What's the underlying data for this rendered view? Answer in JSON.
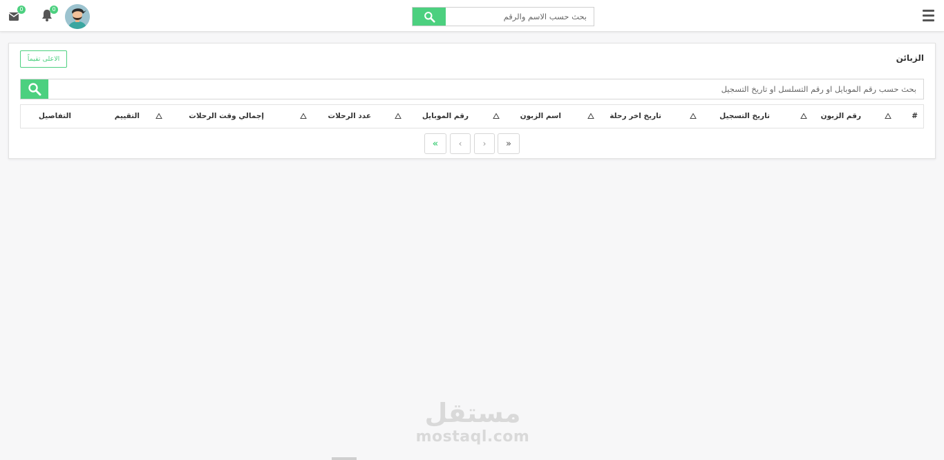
{
  "topbar": {
    "search_placeholder": "بحث حسب الاسم والرقم",
    "notifications_count": "0",
    "messages_count": "0"
  },
  "card": {
    "title": "الزبائن",
    "top_rated_label": "الاعلى تقيماً",
    "search_placeholder": "بحث حسب رقم الموبايل او رقم التسلسل او تاريخ التسجيل"
  },
  "table": {
    "columns": [
      {
        "label": "#"
      },
      {
        "label": "رقم الزبون"
      },
      {
        "label": "تاريخ التسجيل"
      },
      {
        "label": "تاريخ اخر رحلة"
      },
      {
        "label": "اسم الزبون"
      },
      {
        "label": "رقم الموبايل"
      },
      {
        "label": "عدد الرحلات"
      },
      {
        "label": "إجمالي وقت الرحلات"
      },
      {
        "label": "التقييم"
      },
      {
        "label": "التفاصيل"
      }
    ]
  },
  "pagination": {
    "first": "«",
    "prev": "‹",
    "next": "›",
    "last": "»"
  },
  "watermark": {
    "arabic": "مستقل",
    "latin": "mostaql.com"
  },
  "colors": {
    "accent": "#4cd07f",
    "background": "#f7f7f8"
  }
}
